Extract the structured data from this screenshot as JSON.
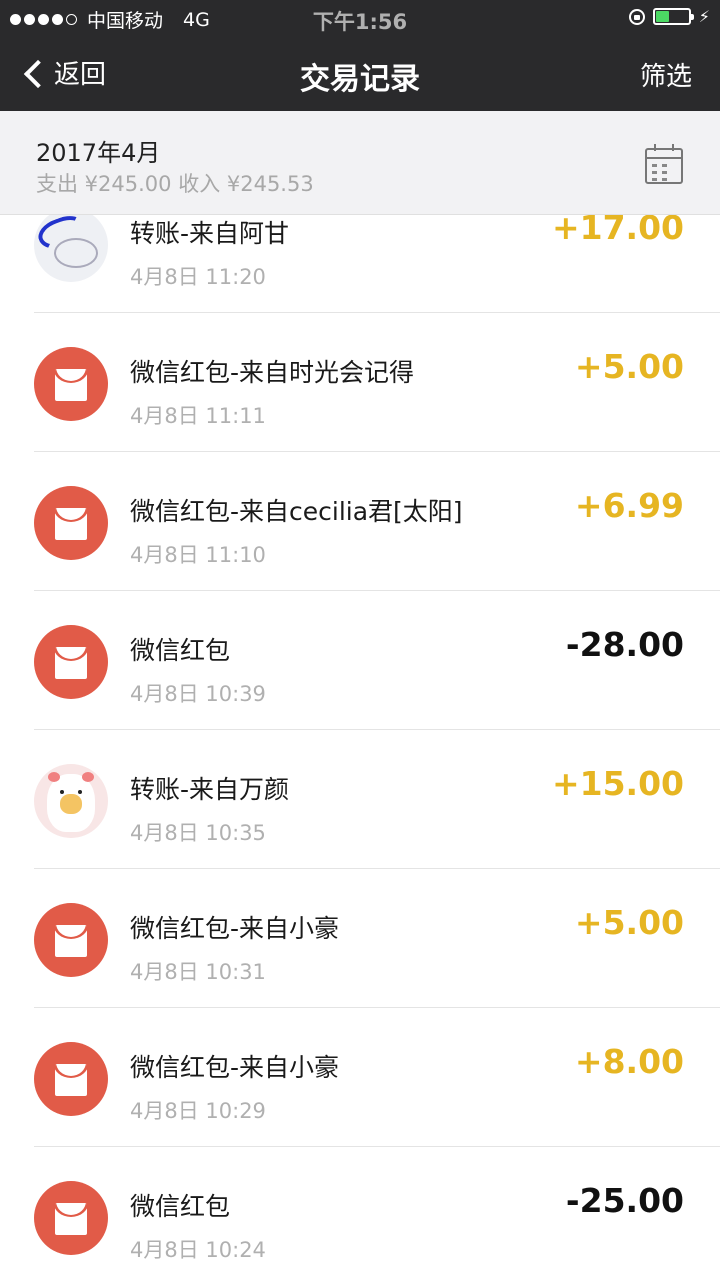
{
  "status_bar": {
    "carrier": "中国移动",
    "network": "4G",
    "time": "下午1:56",
    "signal_bars_filled": 4,
    "signal_bars_total": 5,
    "battery_level": 0.4,
    "battery_color": "#4cd964"
  },
  "nav": {
    "back_label": "返回",
    "title": "交易记录",
    "filter_label": "筛选"
  },
  "summary": {
    "month": "2017年4月",
    "totals": "支出 ¥245.00 收入 ¥245.53",
    "calendar_icon": "calendar-icon"
  },
  "colors": {
    "positive_amount": "#e6b522",
    "negative_amount": "#111111",
    "red_packet": "#e15b48",
    "nav_bg": "#2a2a2c"
  },
  "transactions": [
    {
      "icon": "avatar",
      "title": "转账-来自阿甘",
      "time": "4月8日 11:20",
      "amount": "+17.00",
      "sign": "pos"
    },
    {
      "icon": "red-packet-icon",
      "title": "微信红包-来自时光会记得",
      "time": "4月8日 11:11",
      "amount": "+5.00",
      "sign": "pos"
    },
    {
      "icon": "red-packet-icon",
      "title": "微信红包-来自cecilia君[太阳]",
      "time": "4月8日 11:10",
      "amount": "+6.99",
      "sign": "pos"
    },
    {
      "icon": "red-packet-icon",
      "title": "微信红包",
      "time": "4月8日 10:39",
      "amount": "-28.00",
      "sign": "neg"
    },
    {
      "icon": "avatar",
      "title": "转账-来自万颜",
      "time": "4月8日 10:35",
      "amount": "+15.00",
      "sign": "pos"
    },
    {
      "icon": "red-packet-icon",
      "title": "微信红包-来自小豪",
      "time": "4月8日 10:31",
      "amount": "+5.00",
      "sign": "pos"
    },
    {
      "icon": "red-packet-icon",
      "title": "微信红包-来自小豪",
      "time": "4月8日 10:29",
      "amount": "+8.00",
      "sign": "pos"
    },
    {
      "icon": "red-packet-icon",
      "title": "微信红包",
      "time": "4月8日 10:24",
      "amount": "-25.00",
      "sign": "neg"
    }
  ]
}
